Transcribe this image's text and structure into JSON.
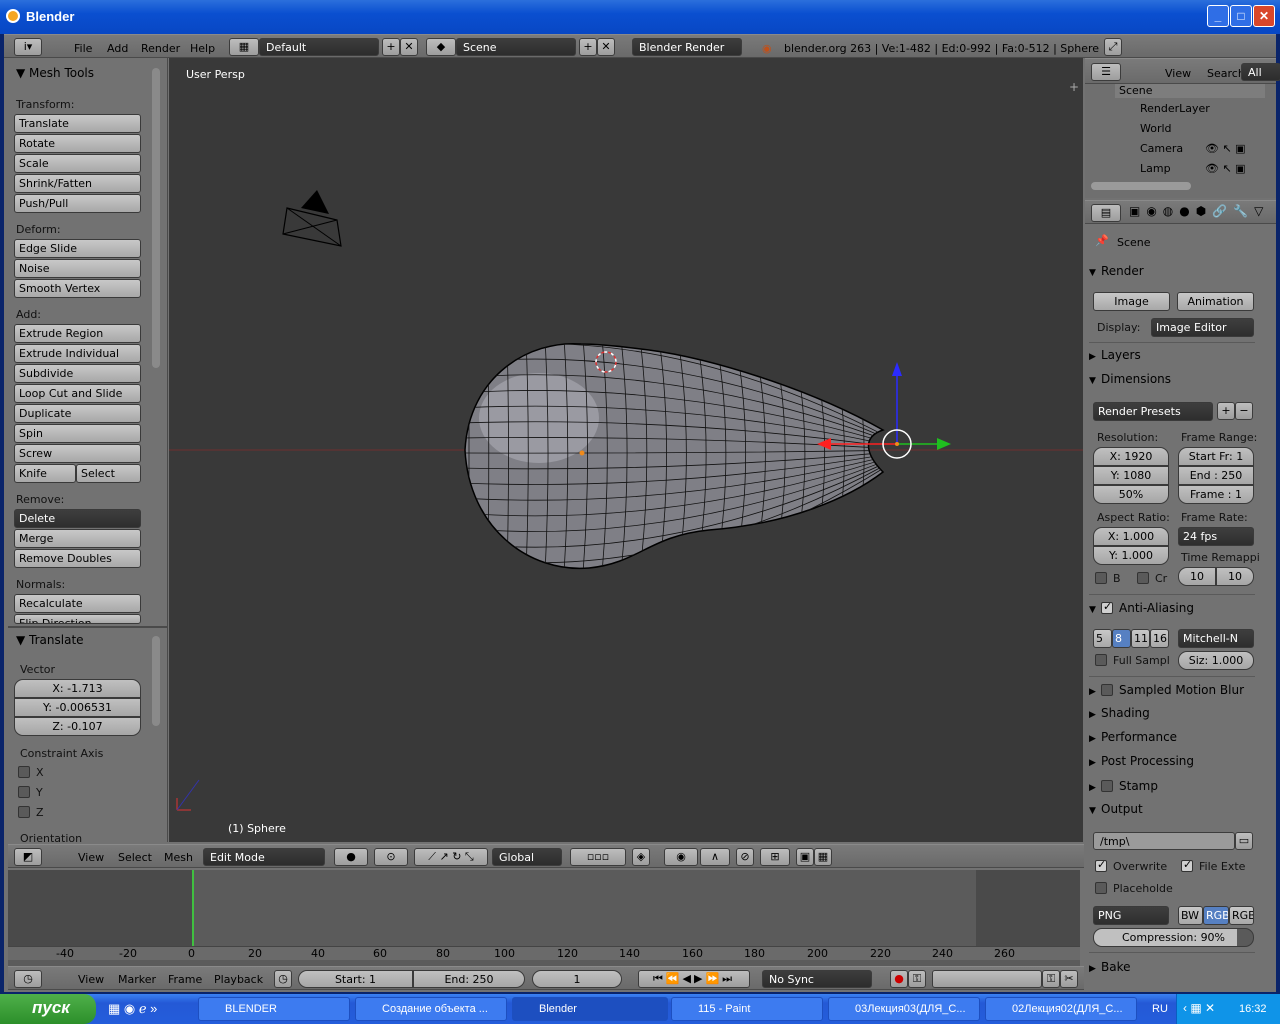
{
  "window": {
    "title": "Blender"
  },
  "info_header": {
    "menus": [
      "File",
      "Add",
      "Render",
      "Help"
    ],
    "layout": "Default",
    "scene": "Scene",
    "engine": "Blender Render",
    "stats": "blender.org 263 | Ve:1-482 | Ed:0-992 | Fa:0-512 | Sphere"
  },
  "toolshelf": {
    "title": "Mesh Tools",
    "transform_label": "Transform:",
    "transform": [
      "Translate",
      "Rotate",
      "Scale",
      "Shrink/Fatten",
      "Push/Pull"
    ],
    "deform_label": "Deform:",
    "deform": [
      "Edge Slide",
      "Noise",
      "Smooth Vertex"
    ],
    "add_label": "Add:",
    "add": [
      "Extrude Region",
      "Extrude Individual",
      "Subdivide",
      "Loop Cut and Slide",
      "Duplicate",
      "Spin",
      "Screw"
    ],
    "knife": "Knife",
    "select": "Select",
    "remove_label": "Remove:",
    "delete": "Delete",
    "remove": [
      "Merge",
      "Remove Doubles"
    ],
    "normals_label": "Normals:",
    "normals": [
      "Recalculate",
      "Flip Direction"
    ]
  },
  "operator": {
    "title": "Translate",
    "vector_label": "Vector",
    "x": "X: -1.713",
    "y": "Y: -0.006531",
    "z": "Z: -0.107",
    "constraint_label": "Constraint Axis",
    "axes": [
      "X",
      "Y",
      "Z"
    ],
    "orientation_label": "Orientation"
  },
  "viewport": {
    "label": "User Persp",
    "object": "(1) Sphere"
  },
  "view3d_header": {
    "menus": [
      "View",
      "Select",
      "Mesh"
    ],
    "mode": "Edit Mode",
    "orientation": "Global"
  },
  "outliner": {
    "menus": [
      "View",
      "Search"
    ],
    "filter": "All Sce",
    "items": [
      "Scene",
      "RenderLayer",
      "World",
      "Camera",
      "Lamp"
    ]
  },
  "properties": {
    "context": "Scene",
    "render_title": "Render",
    "image_btn": "Image",
    "animation_btn": "Animation",
    "display_label": "Display:",
    "display_value": "Image Editor",
    "layers": "Layers",
    "dimensions": "Dimensions",
    "presets": "Render Presets",
    "resolution_label": "Resolution:",
    "res_x": "X: 1920",
    "res_y": "Y: 1080",
    "res_pct": "50%",
    "frame_range_label": "Frame Range:",
    "start_fr": "Start Fr: 1",
    "end_fr": "End : 250",
    "frame": "Frame : 1",
    "aspect_label": "Aspect Ratio:",
    "asp_x": "X: 1.000",
    "asp_y": "Y: 1.000",
    "frame_rate_label": "Frame Rate:",
    "fps": "24 fps",
    "time_remap": "Time Remappi",
    "remap_old": "10",
    "remap_new": "10",
    "b": "B",
    "cr": "Cr",
    "aa": "Anti-Aliasing",
    "aa_samples": [
      "5",
      "8",
      "11",
      "16"
    ],
    "filter": "Mitchell-N",
    "full_sample": "Full Sampl",
    "size": "Siz: 1.000",
    "motion_blur": "Sampled Motion Blur",
    "shading": "Shading",
    "performance": "Performance",
    "post_processing": "Post Processing",
    "stamp": "Stamp",
    "output": "Output",
    "path": "/tmp\\",
    "overwrite": "Overwrite",
    "file_ext": "File Exte",
    "placeholders": "Placeholde",
    "format": "PNG",
    "bw": "BW",
    "rgb": "RGB",
    "rgba": "RGB",
    "compression": "Compression: 90%",
    "bake": "Bake"
  },
  "timeline": {
    "ticks": [
      "-40",
      "-20",
      "0",
      "20",
      "40",
      "60",
      "80",
      "100",
      "120",
      "140",
      "160",
      "180",
      "200",
      "220",
      "240",
      "260"
    ],
    "menus": [
      "View",
      "Marker",
      "Frame",
      "Playback"
    ],
    "start": "Start: 1",
    "end": "End: 250",
    "current": "1",
    "sync": "No Sync"
  },
  "taskbar": {
    "start": "пуск",
    "tasks": [
      "BLENDER",
      "Создание объекта ...",
      "Blender",
      "115 - Paint",
      "03Лекция03(ДЛЯ_С...",
      "02Лекция02(ДЛЯ_С..."
    ],
    "lang": "RU",
    "clock": "16:32"
  },
  "colors": {
    "accent": "#5680c2",
    "bg": "#727272",
    "viewport": "#393939"
  }
}
